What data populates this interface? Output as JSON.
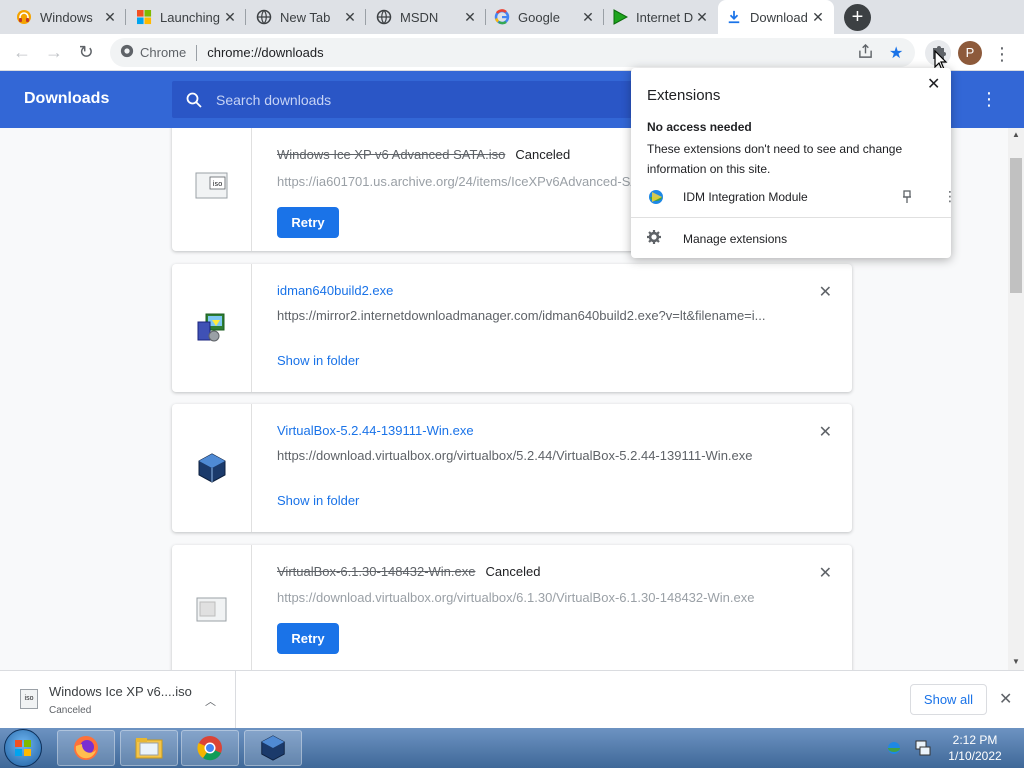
{
  "tabs": [
    {
      "label": "Windows",
      "icon": "headphones-icon"
    },
    {
      "label": "Launching",
      "icon": "microsoft-logo-icon"
    },
    {
      "label": "New Tab",
      "icon": "globe-icon"
    },
    {
      "label": "MSDN",
      "icon": "globe-icon"
    },
    {
      "label": "Google",
      "icon": "google-logo-icon"
    },
    {
      "label": "Internet D",
      "icon": "idm-play-icon"
    },
    {
      "label": "Download",
      "icon": "download-icon",
      "active": true
    }
  ],
  "omnibox": {
    "site": "Chrome",
    "url": "chrome://downloads"
  },
  "downloads_page": {
    "title": "Downloads",
    "search_placeholder": "Search downloads"
  },
  "items": [
    {
      "name": "Windows Ice XP v6 Advanced SATA.iso",
      "status": "Canceled",
      "url": "https://ia601701.us.archive.org/24/items/IceXPv6Advanced-SATA/Windows%20Ice%20XP%20v6%20Advanced%20SATA.iso",
      "action": "Retry",
      "icon": "iso-file-icon"
    },
    {
      "name": "idman640build2.exe",
      "status": "",
      "url": "https://mirror2.internetdownloadmanager.com/idman640build2.exe?v=lt&filename=i...",
      "action": "Show in folder",
      "icon": "idm-installer-icon"
    },
    {
      "name": "VirtualBox-5.2.44-139111-Win.exe",
      "status": "",
      "url": "https://download.virtualbox.org/virtualbox/5.2.44/VirtualBox-5.2.44-139111-Win.exe",
      "action": "Show in folder",
      "icon": "virtualbox-icon"
    },
    {
      "name": "VirtualBox-6.1.30-148432-Win.exe",
      "status": "Canceled",
      "url": "https://download.virtualbox.org/virtualbox/6.1.30/VirtualBox-6.1.30-148432-Win.exe",
      "action": "Retry",
      "icon": "generic-file-icon"
    }
  ],
  "extensions_popup": {
    "title": "Extensions",
    "no_access_heading": "No access needed",
    "no_access_desc": "These extensions don't need to see and change information on this site.",
    "extension_name": "IDM Integration Module",
    "manage_label": "Manage extensions"
  },
  "shelf": {
    "file_name": "Windows Ice XP v6....iso",
    "file_status": "Canceled",
    "file_icon_label": "iso",
    "show_all_label": "Show all"
  },
  "taskbar": {
    "apps": [
      "firefox-icon",
      "file-explorer-icon",
      "chrome-icon",
      "virtualbox-icon"
    ],
    "time": "2:12 PM",
    "date": "1/10/2022"
  },
  "profile": {
    "initial": "P"
  },
  "colors": {
    "accent": "#1a73e8",
    "header": "#3367d6",
    "tabstrip": "#dee1e6"
  }
}
